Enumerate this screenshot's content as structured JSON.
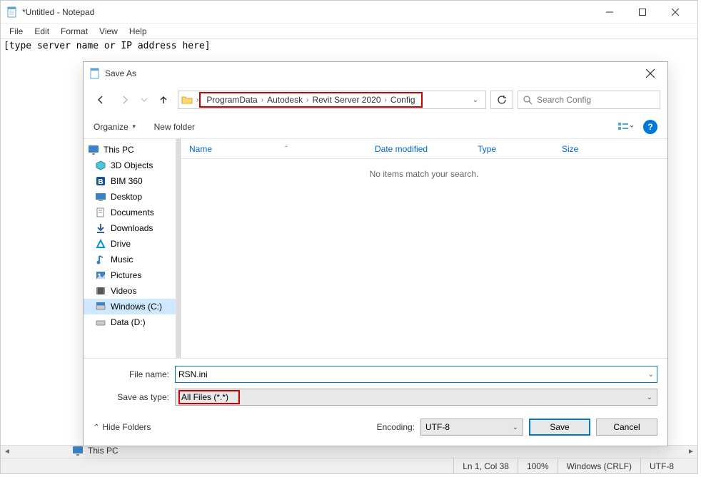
{
  "notepad": {
    "title": "*Untitled - Notepad",
    "menus": [
      "File",
      "Edit",
      "Format",
      "View",
      "Help"
    ],
    "content": "[type server name or IP address here]",
    "statusbar": {
      "position": "Ln 1, Col 38",
      "zoom": "100%",
      "line_ending": "Windows (CRLF)",
      "encoding": "UTF-8"
    },
    "behind_item": "This PC"
  },
  "dialog": {
    "title": "Save As",
    "breadcrumb": [
      "ProgramData",
      "Autodesk",
      "Revit Server 2020",
      "Config"
    ],
    "search_placeholder": "Search Config",
    "toolbar": {
      "organize": "Organize",
      "new_folder": "New folder"
    },
    "sidebar": {
      "root": "This PC",
      "items": [
        {
          "label": "3D Objects",
          "icon": "cube"
        },
        {
          "label": "BIM 360",
          "icon": "bim"
        },
        {
          "label": "Desktop",
          "icon": "desktop"
        },
        {
          "label": "Documents",
          "icon": "docs"
        },
        {
          "label": "Downloads",
          "icon": "downloads"
        },
        {
          "label": "Drive",
          "icon": "drive"
        },
        {
          "label": "Music",
          "icon": "music"
        },
        {
          "label": "Pictures",
          "icon": "pictures"
        },
        {
          "label": "Videos",
          "icon": "videos"
        },
        {
          "label": "Windows (C:)",
          "icon": "disk",
          "selected": true
        },
        {
          "label": "Data (D:)",
          "icon": "disk"
        }
      ]
    },
    "columns": {
      "name": "Name",
      "date": "Date modified",
      "type": "Type",
      "size": "Size"
    },
    "empty_message": "No items match your search.",
    "filename_label": "File name:",
    "filename_value": "RSN.ini",
    "type_label": "Save as type:",
    "type_value": "All Files  (*.*)",
    "hide_folders": "Hide Folders",
    "encoding_label": "Encoding:",
    "encoding_value": "UTF-8",
    "save_label": "Save",
    "cancel_label": "Cancel"
  }
}
